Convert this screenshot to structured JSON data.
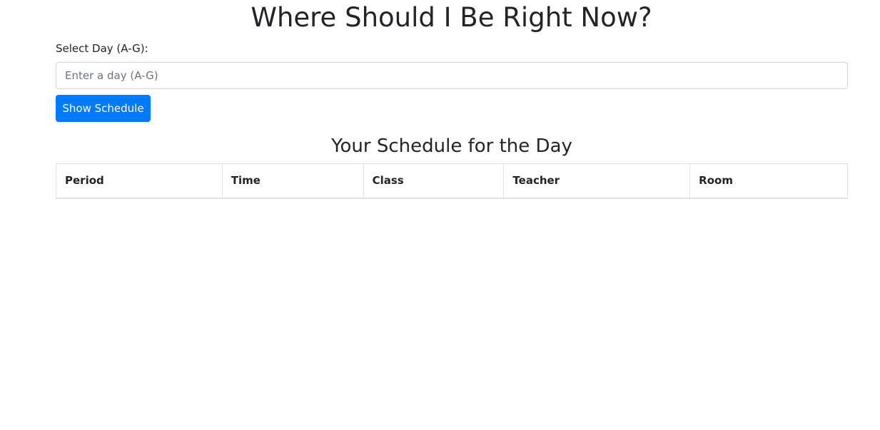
{
  "header": {
    "title": "Where Should I Be Right Now?"
  },
  "form": {
    "day_label": "Select Day (A-G):",
    "day_input_value": "",
    "day_input_placeholder": "Enter a day (A-G)",
    "show_button_label": "Show Schedule"
  },
  "schedule": {
    "heading": "Your Schedule for the Day",
    "columns": [
      "Period",
      "Time",
      "Class",
      "Teacher",
      "Room"
    ],
    "rows": []
  },
  "colors": {
    "primary_button": "#007bff",
    "text": "#212529",
    "border": "#dee2e6"
  }
}
